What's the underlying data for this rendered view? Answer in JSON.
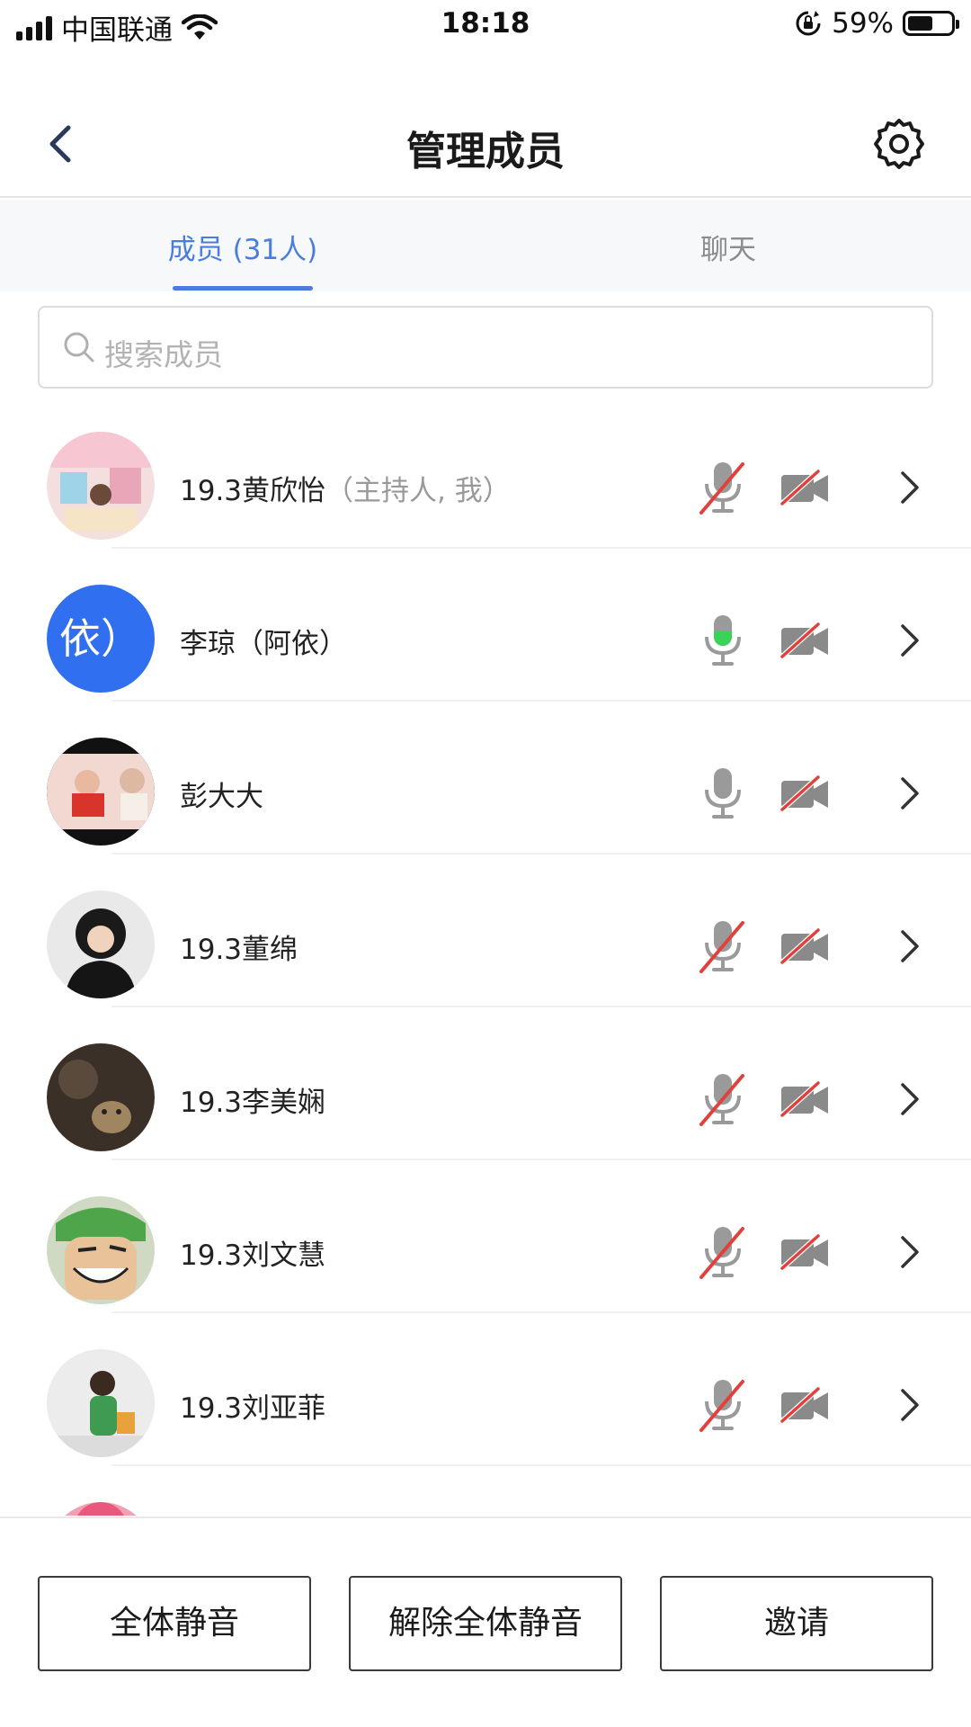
{
  "status_bar": {
    "carrier": "中国联通",
    "time": "18:18",
    "battery_percent": "59%",
    "battery_level": 0.59,
    "icons": [
      "signal-icon",
      "wifi-icon",
      "rotation-lock-icon",
      "battery-icon"
    ]
  },
  "nav": {
    "title": "管理成员",
    "back_icon": "chevron-left-icon",
    "settings_icon": "gear-icon"
  },
  "tabs": [
    {
      "label": "成员 (31人)",
      "active": true
    },
    {
      "label": "聊天",
      "active": false
    }
  ],
  "search": {
    "placeholder": "搜索成员",
    "icon": "search-icon"
  },
  "members": [
    {
      "name": "19.3黄欣怡",
      "role": "（主持人, 我）",
      "avatar": "photo",
      "mic": "muted",
      "camera": "off"
    },
    {
      "name": "李琼（阿依）",
      "role": "",
      "avatar": "text",
      "avatar_text": "依）",
      "avatar_color": "#2f6ff0",
      "mic": "speaking",
      "camera": "off"
    },
    {
      "name": "彭大大",
      "role": "",
      "avatar": "photo",
      "mic": "on",
      "camera": "off"
    },
    {
      "name": "19.3董绵",
      "role": "",
      "avatar": "photo",
      "mic": "muted",
      "camera": "off"
    },
    {
      "name": "19.3李美娴",
      "role": "",
      "avatar": "photo",
      "mic": "muted",
      "camera": "off"
    },
    {
      "name": "19.3刘文慧",
      "role": "",
      "avatar": "photo",
      "mic": "muted",
      "camera": "off"
    },
    {
      "name": "19.3刘亚菲",
      "role": "",
      "avatar": "photo",
      "mic": "muted",
      "camera": "off"
    }
  ],
  "footer": {
    "mute_all": "全体静音",
    "unmute_all": "解除全体静音",
    "invite": "邀请"
  },
  "colors": {
    "accent": "#4a7de0",
    "muted_slash": "#e0413c",
    "speaking": "#3cd157",
    "icon_gray": "#8a8a8a"
  }
}
